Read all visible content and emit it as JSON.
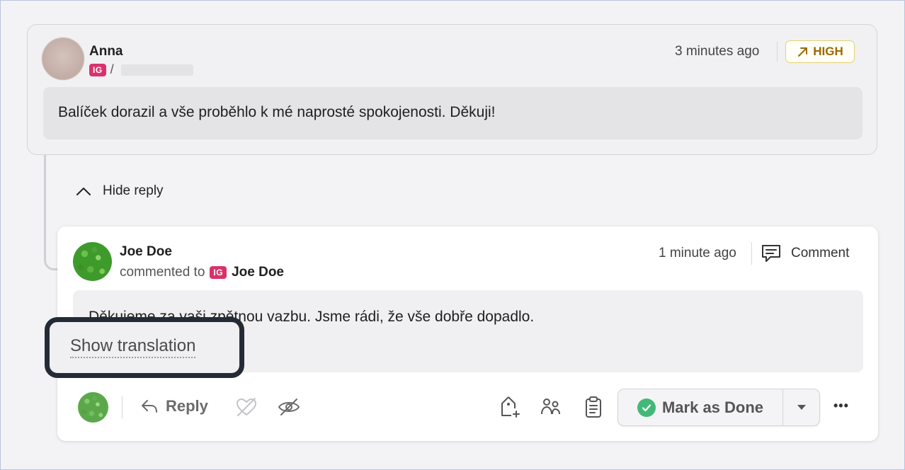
{
  "parent_comment": {
    "author": "Anna",
    "platform_badge": "IG",
    "separator": "/",
    "time": "3 minutes ago",
    "priority": "HIGH",
    "message": "Balíček dorazil a vše proběhlo k mé naprosté spokojenosti. Děkuji!"
  },
  "thread": {
    "toggle_label": "Hide reply"
  },
  "reply": {
    "author": "Joe Doe",
    "commented_to_text": "commented to",
    "platform_badge": "IG",
    "target": "Joe Doe",
    "time": "1 minute ago",
    "type_label": "Comment",
    "message": "Děkujeme za vaši zpětnou vazbu. Jsme rádi, že vše dobře dopadlo.",
    "show_translation": "Show translation"
  },
  "actions": {
    "reply_label": "Reply",
    "mark_done_label": "Mark as Done",
    "more_label": "•••"
  },
  "colors": {
    "ig_badge": "#d9326b",
    "high_text": "#9a6a00",
    "high_border": "#e6cf74",
    "done_check": "#44b878"
  }
}
